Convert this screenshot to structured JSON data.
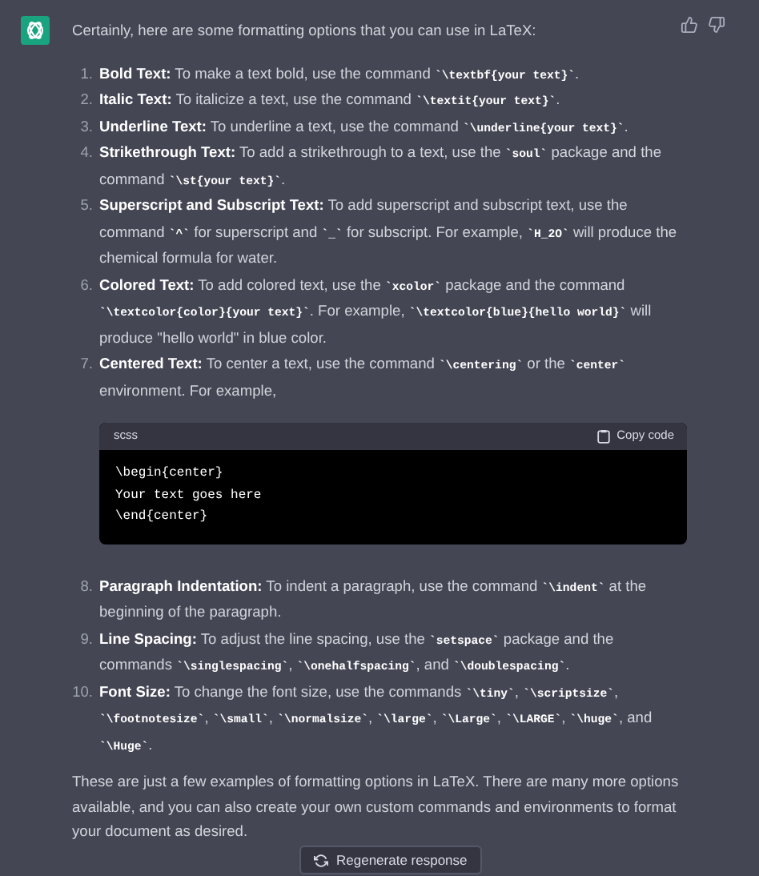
{
  "message": {
    "intro": "Certainly, here are some formatting options that you can use in LaTeX:",
    "items": [
      {
        "number": "1.",
        "label": "Bold Text:",
        "parts": [
          {
            "kind": "text",
            "text": " To make a text bold, use the command "
          },
          {
            "kind": "code",
            "text": "`\\textbf{your text}`"
          },
          {
            "kind": "text",
            "text": "."
          }
        ]
      },
      {
        "number": "2.",
        "label": "Italic Text:",
        "parts": [
          {
            "kind": "text",
            "text": " To italicize a text, use the command "
          },
          {
            "kind": "code",
            "text": "`\\textit{your text}`"
          },
          {
            "kind": "text",
            "text": "."
          }
        ]
      },
      {
        "number": "3.",
        "label": "Underline Text:",
        "parts": [
          {
            "kind": "text",
            "text": " To underline a text, use the command "
          },
          {
            "kind": "code",
            "text": "`\\underline{your text}`"
          },
          {
            "kind": "text",
            "text": "."
          }
        ]
      },
      {
        "number": "4.",
        "label": "Strikethrough Text:",
        "parts": [
          {
            "kind": "text",
            "text": " To add a strikethrough to a text, use the "
          },
          {
            "kind": "code",
            "text": "`soul`"
          },
          {
            "kind": "text",
            "text": " package and the command "
          },
          {
            "kind": "code",
            "text": "`\\st{your text}`"
          },
          {
            "kind": "text",
            "text": "."
          }
        ]
      },
      {
        "number": "5.",
        "label": "Superscript and Subscript Text:",
        "parts": [
          {
            "kind": "text",
            "text": " To add superscript and subscript text, use the command "
          },
          {
            "kind": "code",
            "text": "`^`"
          },
          {
            "kind": "text",
            "text": " for superscript and "
          },
          {
            "kind": "code",
            "text": "`_`"
          },
          {
            "kind": "text",
            "text": " for subscript. For example, "
          },
          {
            "kind": "code",
            "text": "`H_2O`"
          },
          {
            "kind": "text",
            "text": " will produce the chemical formula for water."
          }
        ]
      },
      {
        "number": "6.",
        "label": "Colored Text:",
        "parts": [
          {
            "kind": "text",
            "text": " To add colored text, use the "
          },
          {
            "kind": "code",
            "text": "`xcolor`"
          },
          {
            "kind": "text",
            "text": " package and the command "
          },
          {
            "kind": "code",
            "text": "`\\textcolor{color}{your text}`"
          },
          {
            "kind": "text",
            "text": ". For example, "
          },
          {
            "kind": "code",
            "text": "`\\textcolor{blue}{hello world}`"
          },
          {
            "kind": "text",
            "text": " will produce \"hello world\" in blue color."
          }
        ]
      },
      {
        "number": "7.",
        "label": "Centered Text:",
        "parts": [
          {
            "kind": "text",
            "text": " To center a text, use the command "
          },
          {
            "kind": "code",
            "text": "`\\centering`"
          },
          {
            "kind": "text",
            "text": " or the "
          },
          {
            "kind": "code",
            "text": "`center`"
          },
          {
            "kind": "text",
            "text": " environment. For example,"
          }
        ]
      }
    ],
    "code_block": {
      "language": "scss",
      "copy_label": "Copy code",
      "lines": [
        "\\begin{center}",
        "Your text goes here",
        "\\end{center}"
      ]
    },
    "items_after": [
      {
        "number": "8.",
        "label": "Paragraph Indentation:",
        "parts": [
          {
            "kind": "text",
            "text": " To indent a paragraph, use the command "
          },
          {
            "kind": "code",
            "text": "`\\indent`"
          },
          {
            "kind": "text",
            "text": " at the beginning of the paragraph."
          }
        ]
      },
      {
        "number": "9.",
        "label": "Line Spacing:",
        "parts": [
          {
            "kind": "text",
            "text": " To adjust the line spacing, use the "
          },
          {
            "kind": "code",
            "text": "`setspace`"
          },
          {
            "kind": "text",
            "text": " package and the commands "
          },
          {
            "kind": "code",
            "text": "`\\singlespacing`"
          },
          {
            "kind": "text",
            "text": ", "
          },
          {
            "kind": "code",
            "text": "`\\onehalfspacing`"
          },
          {
            "kind": "text",
            "text": ", and "
          },
          {
            "kind": "code",
            "text": "`\\doublespacing`"
          },
          {
            "kind": "text",
            "text": "."
          }
        ]
      },
      {
        "number": "10.",
        "label": "Font Size:",
        "parts": [
          {
            "kind": "text",
            "text": " To change the font size, use the commands "
          },
          {
            "kind": "code",
            "text": "`\\tiny`"
          },
          {
            "kind": "text",
            "text": ", "
          },
          {
            "kind": "code",
            "text": "`\\scriptsize`"
          },
          {
            "kind": "text",
            "text": ", "
          },
          {
            "kind": "code",
            "text": "`\\footnotesize`"
          },
          {
            "kind": "text",
            "text": ", "
          },
          {
            "kind": "code",
            "text": "`\\small`"
          },
          {
            "kind": "text",
            "text": ", "
          },
          {
            "kind": "code",
            "text": "`\\normalsize`"
          },
          {
            "kind": "text",
            "text": ", "
          },
          {
            "kind": "code",
            "text": "`\\large`"
          },
          {
            "kind": "text",
            "text": ", "
          },
          {
            "kind": "code",
            "text": "`\\Large`"
          },
          {
            "kind": "text",
            "text": ", "
          },
          {
            "kind": "code",
            "text": "`\\LARGE`"
          },
          {
            "kind": "text",
            "text": ", "
          },
          {
            "kind": "code",
            "text": "`\\huge`"
          },
          {
            "kind": "text",
            "text": ", and "
          },
          {
            "kind": "code",
            "text": "`\\Huge`"
          },
          {
            "kind": "text",
            "text": "."
          }
        ]
      }
    ],
    "closing": "These are just a few examples of formatting options in LaTeX. There are many more options available, and you can also create your own custom commands and environments to format your document as desired."
  },
  "regenerate_button": "Regenerate response"
}
